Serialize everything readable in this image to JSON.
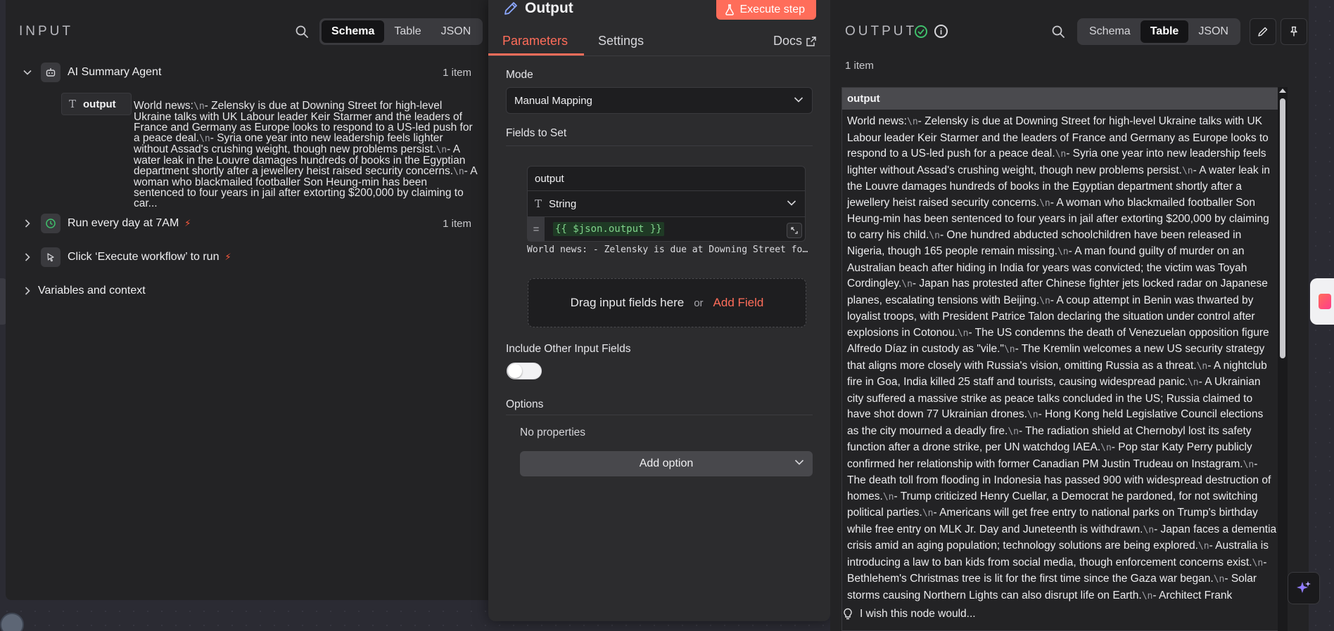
{
  "input": {
    "title": "INPUT",
    "view_tabs": [
      "Schema",
      "Table",
      "JSON"
    ],
    "active_tab": "Schema",
    "tree": [
      {
        "label": "AI Summary Agent",
        "count": "1 item",
        "expanded": true
      },
      {
        "label": "Run every day at 7AM",
        "count": "1 item",
        "expanded": false
      },
      {
        "label": "Click ‘Execute workflow’ to run",
        "count": "",
        "expanded": false
      },
      {
        "label": "Variables and context",
        "count": "",
        "expanded": false
      }
    ],
    "field": {
      "name": "output",
      "type_icon": "T",
      "value_segments": [
        {
          "t": "World news:"
        },
        {
          "nl": "\\n"
        },
        {
          "t": "- Zelensky is due at Downing Street for high-level Ukraine talks with UK Labour leader Keir Starmer and the leaders of France and Germany as Europe looks to respond to a US-led push for a peace deal."
        },
        {
          "nl": "\\n"
        },
        {
          "t": "- Syria one year into new leadership feels lighter without Assad's crushing weight, though new problems persist."
        },
        {
          "nl": "\\n"
        },
        {
          "t": "- A water leak in the Louvre damages hundreds of books in the Egyptian department shortly after a jewellery heist raised security concerns."
        },
        {
          "nl": "\\n"
        },
        {
          "t": "- A woman who blackmailed footballer Son Heung-min has been sentenced to four years in jail after extorting $200,000 by claiming to car..."
        }
      ]
    }
  },
  "node": {
    "title": "Output",
    "execute_label": "Execute step",
    "tabs": [
      "Parameters",
      "Settings"
    ],
    "active_tab": "Parameters",
    "docs_label": "Docs",
    "mode_label": "Mode",
    "mode_value": "Manual Mapping",
    "fields_to_set_label": "Fields to Set",
    "assignment": {
      "name": "output",
      "type": "String",
      "expression": "{{ $json.output }}",
      "preview": "World news: - Zelensky is due at Downing Street for high-level Ukraine talks"
    },
    "drop_hint": "Drag input fields here",
    "drop_or": "or",
    "add_field": "Add Field",
    "include_other_label": "Include Other Input Fields",
    "include_other_on": false,
    "options_label": "Options",
    "no_properties": "No properties",
    "add_option": "Add option"
  },
  "output": {
    "title": "OUTPUT",
    "view_tabs": [
      "Schema",
      "Table",
      "JSON"
    ],
    "active_tab": "Table",
    "items_count": "1 item",
    "column": "output",
    "cell_segments": [
      {
        "t": "World news:"
      },
      {
        "nl": "\\n"
      },
      {
        "t": "- Zelensky is due at Downing Street for high-level Ukraine talks with UK Labour leader Keir Starmer and the leaders of France and Germany as Europe looks to respond to a US-led push for a peace deal."
      },
      {
        "nl": "\\n"
      },
      {
        "t": "- Syria one year into new leadership feels lighter without Assad's crushing weight, though new problems persist."
      },
      {
        "nl": "\\n"
      },
      {
        "t": "- A water leak in the Louvre damages hundreds of books in the Egyptian department shortly after a jewellery heist raised security concerns."
      },
      {
        "nl": "\\n"
      },
      {
        "t": "- A woman who blackmailed footballer Son Heung-min has been sentenced to four years in jail after extorting $200,000 by claiming to carry his child."
      },
      {
        "nl": "\\n"
      },
      {
        "t": "- One hundred abducted schoolchildren have been released in Nigeria, though 165 people remain missing."
      },
      {
        "nl": "\\n"
      },
      {
        "t": "- A man found guilty of murder on an Australian beach after hiding in India for years was convicted; the victim was Toyah Cordingley."
      },
      {
        "nl": "\\n"
      },
      {
        "t": "- Japan has protested after Chinese fighter jets locked radar on Japanese planes, escalating tensions with Beijing."
      },
      {
        "nl": "\\n"
      },
      {
        "t": "- A coup attempt in Benin was thwarted by loyalist troops, with President Patrice Talon declaring the situation under control after explosions in Cotonou."
      },
      {
        "nl": "\\n"
      },
      {
        "t": "- The US condemns the death of Venezuelan opposition figure Alfredo Díaz in custody as \"vile.\""
      },
      {
        "nl": "\\n"
      },
      {
        "t": "- The Kremlin welcomes a new US security strategy that aligns more closely with Russia's vision, omitting Russia as a threat."
      },
      {
        "nl": "\\n"
      },
      {
        "t": "- A nightclub fire in Goa, India killed 25 staff and tourists, causing widespread panic."
      },
      {
        "nl": "\\n"
      },
      {
        "t": "- A Ukrainian city suffered a massive strike as peace talks concluded in the US; Russia claimed to have shot down 77 Ukrainian drones."
      },
      {
        "nl": "\\n"
      },
      {
        "t": "- Hong Kong held Legislative Council elections as the city mourned a deadly fire."
      },
      {
        "nl": "\\n"
      },
      {
        "t": "- The radiation shield at Chernobyl lost its safety function after a drone strike, per UN watchdog IAEA."
      },
      {
        "nl": "\\n"
      },
      {
        "t": "- Pop star Katy Perry publicly confirmed her relationship with former Canadian PM Justin Trudeau on Instagram."
      },
      {
        "nl": "\\n"
      },
      {
        "t": "- The death toll from flooding in Indonesia has passed 900 with widespread destruction of homes."
      },
      {
        "nl": "\\n"
      },
      {
        "t": "- Trump criticized Henry Cuellar, a Democrat he pardoned, for not switching political parties."
      },
      {
        "nl": "\\n"
      },
      {
        "t": "- Americans will get free entry to national parks on Trump's birthday while free entry on MLK Jr. Day and Juneteenth is withdrawn."
      },
      {
        "nl": "\\n"
      },
      {
        "t": "- Japan faces a dementia crisis amid an aging population; technology solutions are being explored."
      },
      {
        "nl": "\\n"
      },
      {
        "t": "- Australia is introducing a law to ban kids from social media, though enforcement concerns exist."
      },
      {
        "nl": "\\n"
      },
      {
        "t": "- Bethlehem's Christmas tree is lit for the first time since the Gaza war began."
      },
      {
        "nl": "\\n"
      },
      {
        "t": "- Solar storms causing Northern Lights can also disrupt life on Earth."
      },
      {
        "nl": "\\n"
      },
      {
        "t": "- Architect Frank"
      }
    ],
    "feedback": "I wish this node would..."
  },
  "colors": {
    "accent": "#ff6d5a",
    "success": "#3fbf6b",
    "expression_green": "#7fd38a",
    "trigger_bolt": "#ff5a3c"
  }
}
